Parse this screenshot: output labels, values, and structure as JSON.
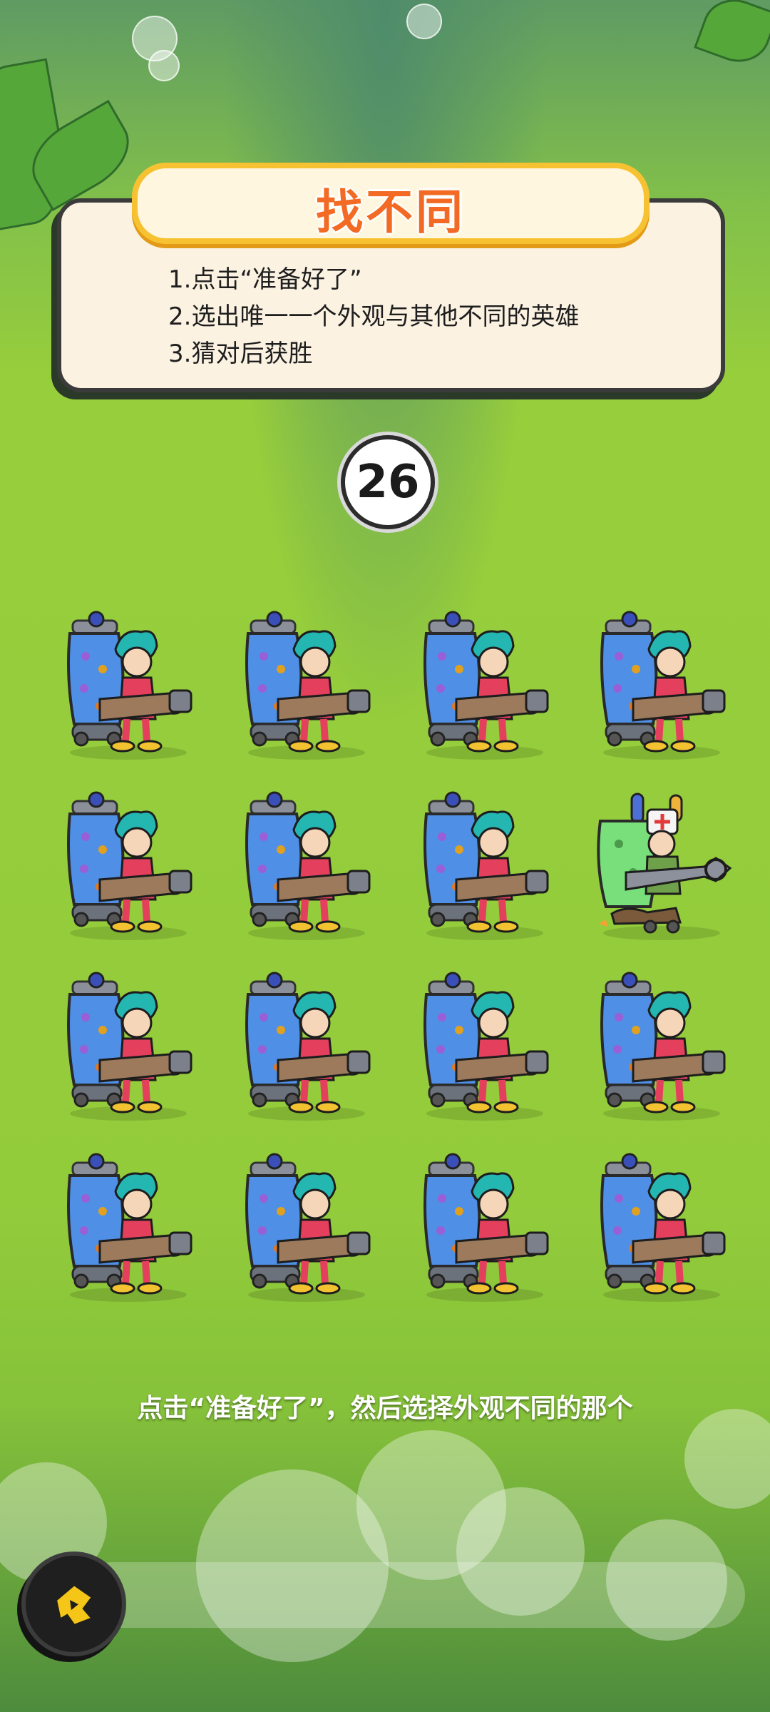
{
  "game": {
    "title": "找不同",
    "rules": [
      "1.点击“准备好了”",
      "2.选出唯一一个外观与其他不同的英雄",
      "3.猜对后获胜"
    ],
    "countdown": "26",
    "hint": "点击“准备好了”，然后选择外观不同的那个"
  },
  "grid": {
    "rows": 4,
    "cols": 4,
    "cells": [
      {
        "hero": "blue-tank-hero",
        "odd": false
      },
      {
        "hero": "blue-tank-hero",
        "odd": false
      },
      {
        "hero": "blue-tank-hero",
        "odd": false
      },
      {
        "hero": "blue-tank-hero",
        "odd": false
      },
      {
        "hero": "blue-tank-hero",
        "odd": false
      },
      {
        "hero": "blue-tank-hero",
        "odd": false
      },
      {
        "hero": "blue-tank-hero",
        "odd": false
      },
      {
        "hero": "green-tank-hero",
        "odd": true
      },
      {
        "hero": "blue-tank-hero",
        "odd": false
      },
      {
        "hero": "blue-tank-hero",
        "odd": false
      },
      {
        "hero": "blue-tank-hero",
        "odd": false
      },
      {
        "hero": "blue-tank-hero",
        "odd": false
      },
      {
        "hero": "blue-tank-hero",
        "odd": false
      },
      {
        "hero": "blue-tank-hero",
        "odd": false
      },
      {
        "hero": "blue-tank-hero",
        "odd": false
      },
      {
        "hero": "blue-tank-hero",
        "odd": false
      }
    ]
  },
  "colors": {
    "grass": "#93cc3b",
    "banner_border": "#f7c232",
    "title": "#f26a23",
    "panel": "#fbf2e2"
  },
  "icons": {
    "fab": "game-logo-icon"
  }
}
